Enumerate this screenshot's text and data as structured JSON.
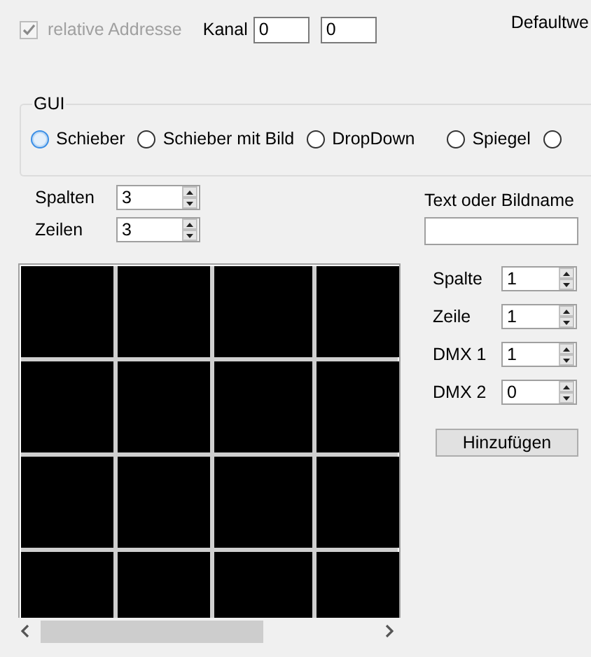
{
  "top_row": {
    "relative_address": {
      "label": "relative Addresse",
      "checked": true,
      "disabled": true
    },
    "channel_label": "Kanal",
    "channel_values": [
      "0",
      "0"
    ],
    "default_label": "Defaultwe"
  },
  "gui_group": {
    "title": "GUI",
    "options": [
      {
        "label": "Schieber",
        "selected": false,
        "focused": true
      },
      {
        "label": "Schieber mit Bild",
        "selected": false,
        "focused": false
      },
      {
        "label": "DropDown",
        "selected": false,
        "focused": false
      },
      {
        "label": "Spiegel",
        "selected": false,
        "focused": false
      },
      {
        "selected": false,
        "focused": false
      }
    ]
  },
  "size_fields": [
    {
      "label": "Spalten",
      "value": "3"
    },
    {
      "label": "Zeilen",
      "value": "3"
    }
  ],
  "grid": {
    "rows": [
      {
        "cells": [
          {
            "kind": "black"
          },
          {
            "kind": "black"
          },
          {
            "kind": "black"
          },
          {
            "kind": "black"
          }
        ]
      },
      {
        "cells": [
          {
            "kind": "black"
          },
          {
            "kind": "black"
          },
          {
            "kind": "black"
          },
          {
            "kind": "black"
          }
        ]
      },
      {
        "cells": [
          {
            "kind": "black"
          },
          {
            "kind": "black"
          },
          {
            "kind": "black"
          },
          {
            "kind": "black"
          }
        ]
      },
      {
        "cells": [
          {
            "kind": "black"
          },
          {
            "kind": "black"
          },
          {
            "kind": "black"
          },
          {
            "kind": "black"
          }
        ]
      }
    ]
  },
  "text_field": {
    "label": "Text oder Bildname"
  },
  "cell_fields": [
    {
      "label": "Spalte",
      "value": "1"
    },
    {
      "label": "Zeile",
      "value": "1"
    },
    {
      "label": "DMX 1",
      "value": "1"
    },
    {
      "label": "DMX 2",
      "value": "0"
    }
  ],
  "add_button": "Hinzufügen"
}
